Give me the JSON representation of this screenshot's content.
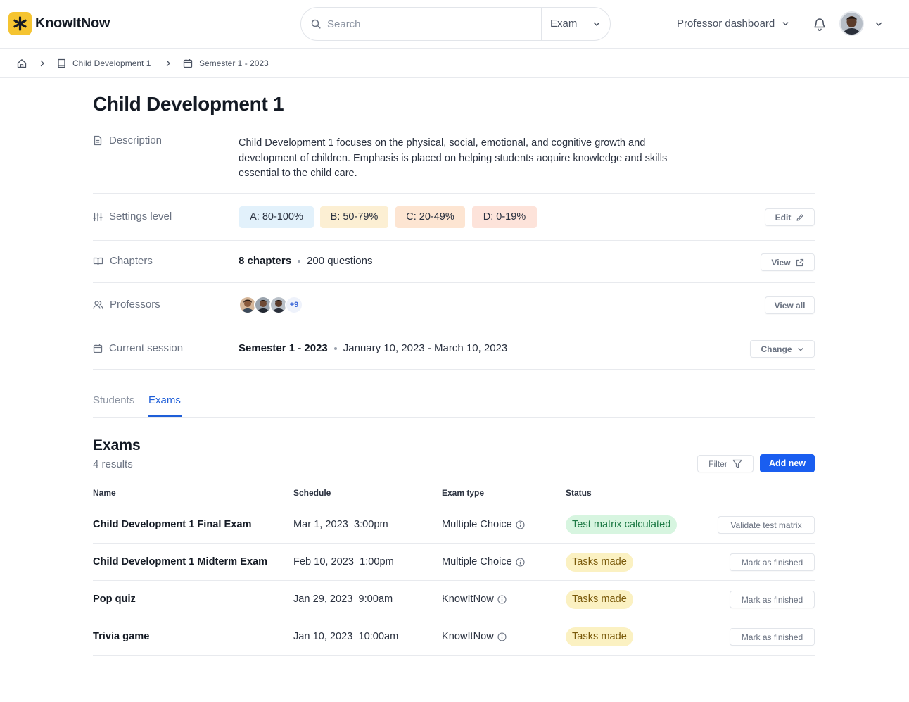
{
  "app": {
    "name": "KnowItNow"
  },
  "header": {
    "search_placeholder": "Search",
    "search_scope": "Exam",
    "dashboard_label": "Professor dashboard"
  },
  "breadcrumb": {
    "items": [
      "Child Development 1",
      "Semester 1 - 2023"
    ]
  },
  "course": {
    "title": "Child Development 1",
    "description_label": "Description",
    "description": "Child Development 1 focuses on the physical, social, emotional, and cognitive growth and development of children. Emphasis is placed on helping students acquire knowledge and skills essential to the child care.",
    "settings_label": "Settings level",
    "grade_levels": [
      {
        "label": "A: 80-100%",
        "color": "#e2f1fb"
      },
      {
        "label": "B: 50-79%",
        "color": "#fcefd3"
      },
      {
        "label": "C: 20-49%",
        "color": "#fde5d2"
      },
      {
        "label": "D:  0-19%",
        "color": "#fde3da"
      }
    ],
    "edit_label": "Edit",
    "chapters_label": "Chapters",
    "chapters_count": "8 chapters",
    "questions_count": "200 questions",
    "view_label": "View",
    "professors_label": "Professors",
    "professors_more": "+9",
    "view_all_label": "View all",
    "session_label": "Current session",
    "session_name": "Semester 1 - 2023",
    "session_dates": "January 10, 2023 - March 10, 2023",
    "change_label": "Change"
  },
  "tabs": [
    {
      "label": "Students",
      "active": false
    },
    {
      "label": "Exams",
      "active": true
    }
  ],
  "exams": {
    "title": "Exams",
    "results": "4 results",
    "filter_label": "Filter",
    "add_label": "Add new",
    "columns": [
      "Name",
      "Schedule",
      "Exam type",
      "Status"
    ],
    "rows": [
      {
        "name": "Child Development 1 Final Exam",
        "schedule": "Mar 1, 2023  3:00pm",
        "type": "Multiple Choice",
        "status": "Test matrix calculated",
        "status_color": "green",
        "action": "Validate test matrix"
      },
      {
        "name": "Child Development 1 Midterm Exam",
        "schedule": "Feb 10, 2023  1:00pm",
        "type": "Multiple Choice",
        "status": "Tasks made",
        "status_color": "yellow",
        "action": "Mark as finished"
      },
      {
        "name": "Pop quiz",
        "schedule": "Jan 29, 2023  9:00am",
        "type": "KnowItNow",
        "status": "Tasks made",
        "status_color": "yellow",
        "action": "Mark as finished"
      },
      {
        "name": "Trivia game",
        "schedule": "Jan 10, 2023  10:00am",
        "type": "KnowItNow",
        "status": "Tasks made",
        "status_color": "yellow",
        "action": "Mark as finished"
      }
    ]
  },
  "colors": {
    "primary": "#1a5ef0",
    "brand": "#f5c431"
  }
}
